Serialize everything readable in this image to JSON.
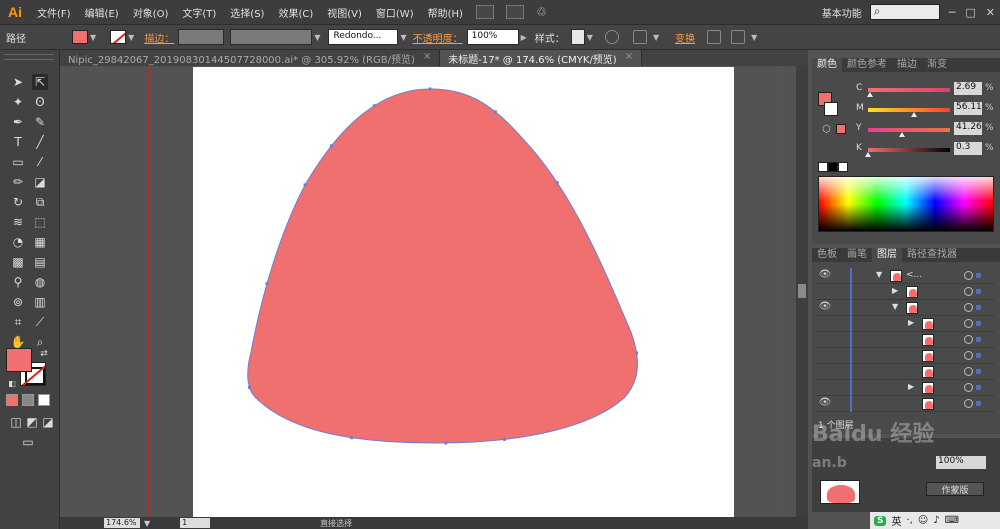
{
  "app": {
    "logo": "Ai",
    "workspace": "基本功能"
  },
  "menu": [
    "文件(F)",
    "编辑(E)",
    "对象(O)",
    "文字(T)",
    "选择(S)",
    "效果(C)",
    "视图(V)",
    "窗口(W)",
    "帮助(H)"
  ],
  "window_controls": [
    "─",
    "□",
    "✕"
  ],
  "control_bar": {
    "object_type": "路径",
    "stroke_label": "描边：",
    "brush_value": "Redondo...",
    "opacity_label": "不透明度：",
    "opacity_value": "100%",
    "style_label": "样式：",
    "transform_label": "变换"
  },
  "tabs": [
    {
      "label": "Nipic_29842067_20190830144507728000.ai* @ 305.92% (RGB/预览)",
      "active": false
    },
    {
      "label": "未标题-17* @ 174.6% (CMYK/预览)",
      "active": true
    }
  ],
  "tab_close": "×",
  "colors": {
    "fill": "#f07070",
    "stroke": "#ffffff",
    "path": "#6c7fd6",
    "accent": "#ff9a40"
  },
  "color_panel": {
    "tabs": [
      "颜色",
      "颜色参考",
      "描边",
      "渐变"
    ],
    "rows": [
      {
        "label": "C",
        "value": "2.69",
        "fraction": 0.0269,
        "grad": "linear-gradient(to right,#f07070,#e04070)"
      },
      {
        "label": "M",
        "value": "56.11",
        "fraction": 0.5611,
        "grad": "linear-gradient(to right,#ffe020,#ff4030)"
      },
      {
        "label": "Y",
        "value": "41.26",
        "fraction": 0.4126,
        "grad": "linear-gradient(to right,#e84090,#f07040)"
      },
      {
        "label": "K",
        "value": "0.3",
        "fraction": 0.003,
        "grad": "linear-gradient(to right,#f07070,#000000)"
      }
    ],
    "unit": "%"
  },
  "layers_panel": {
    "tabs": [
      "色板",
      "画笔",
      "图层",
      "路径查找器"
    ],
    "active_tab": "图层",
    "footer": "1 个图层",
    "rows": [
      {
        "eye": true,
        "indent": 0,
        "expanded": true,
        "name": "<..."
      },
      {
        "eye": false,
        "indent": 1,
        "expanded": false,
        "name": ""
      },
      {
        "eye": true,
        "indent": 1,
        "expanded": true,
        "name": ""
      },
      {
        "eye": false,
        "indent": 2,
        "expanded": false,
        "name": ""
      },
      {
        "eye": false,
        "indent": 2,
        "expanded": null,
        "name": ""
      },
      {
        "eye": false,
        "indent": 2,
        "expanded": null,
        "name": ""
      },
      {
        "eye": false,
        "indent": 2,
        "expanded": null,
        "name": ""
      },
      {
        "eye": false,
        "indent": 2,
        "expanded": false,
        "name": ""
      },
      {
        "eye": true,
        "indent": 2,
        "expanded": null,
        "name": ""
      }
    ]
  },
  "lower_panel": {
    "value": "100%",
    "button": "作蒙版"
  },
  "status_bar": {
    "zoom": "174.6%",
    "page": "1",
    "tool": "直接选择"
  },
  "watermark": "Baidu 经验",
  "watermark_url": "an.b",
  "taskbar": {
    "ime": "S",
    "lang": "英"
  }
}
